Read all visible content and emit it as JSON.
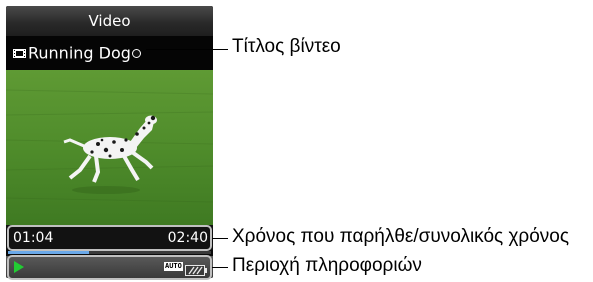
{
  "screen": {
    "title": "Video",
    "video_name": "Running Dog",
    "elapsed_time": "01:04",
    "total_time": "02:40",
    "progress_fraction": 0.4,
    "play_state_icon": "play-icon",
    "auto_indicator": "AUTO",
    "battery_icon": "battery-icon"
  },
  "callouts": {
    "video_title": "Τίτλος βίντεο",
    "elapsed_total": "Χρόνος που παρήλθε/συνολικός χρόνος",
    "info_area": "Περιοχή πληροφοριών"
  },
  "colors": {
    "play": "#22cc33",
    "progress": "#6aa8e8",
    "grass": "#4e8a2a"
  }
}
